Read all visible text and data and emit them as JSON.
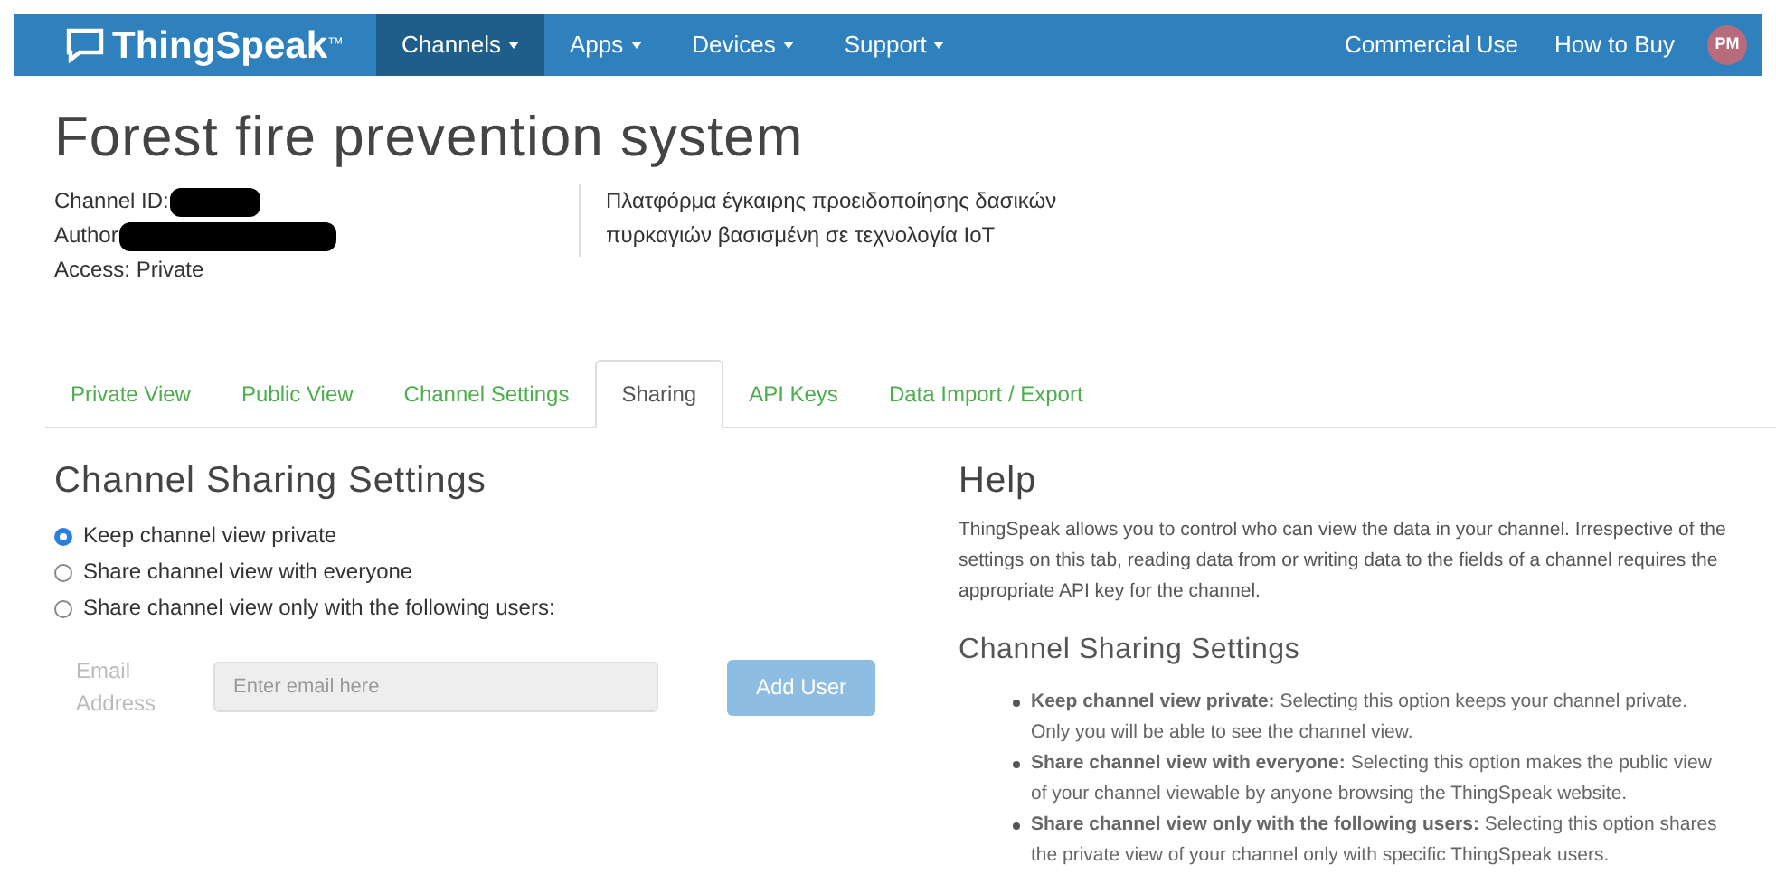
{
  "navbar": {
    "brand": "ThingSpeak",
    "trademark": "™",
    "menus": [
      {
        "label": "Channels",
        "selected": true
      },
      {
        "label": "Apps",
        "selected": false
      },
      {
        "label": "Devices",
        "selected": false
      },
      {
        "label": "Support",
        "selected": false
      }
    ],
    "right_links": [
      "Commercial Use",
      "How to Buy"
    ],
    "avatar": "PM"
  },
  "channel": {
    "title": "Forest fire prevention system",
    "info": [
      {
        "text": "Channel ID:",
        "redacted": true
      },
      {
        "text": "Author",
        "redacted": true
      },
      {
        "text": "Access: Private",
        "redacted": false
      }
    ],
    "description": "Πλατφόρμα   έγκαιρης προειδοποίησης δασικών πυρκαγιών βασισμένη σε τεχνολογία IoT"
  },
  "tabs": [
    {
      "label": "Private View",
      "selected": false
    },
    {
      "label": "Public View",
      "selected": false
    },
    {
      "label": "Channel Settings",
      "selected": false
    },
    {
      "label": "Sharing",
      "selected": true
    },
    {
      "label": "API Keys",
      "selected": false
    },
    {
      "label": "Data Import / Export",
      "selected": false
    }
  ],
  "sharing": {
    "heading": "Channel Sharing Settings",
    "options": [
      {
        "label": "Keep channel view private",
        "selected": true
      },
      {
        "label": "Share channel view with everyone",
        "selected": false
      },
      {
        "label": "Share channel view only with the following users:",
        "selected": false
      }
    ],
    "email_label": "Email Address",
    "email_placeholder": "Enter email here",
    "add_button": "Add User",
    "disabled": true
  },
  "help": {
    "heading": "Help",
    "intro": "ThingSpeak allows you to control who can view the data in your channel. Irrespective of the settings on this tab, reading data from or writing data to the fields of a channel requires the appropriate API key for the channel.",
    "subheading": "Channel Sharing Settings",
    "items": [
      "**Keep channel view private:** Selecting this option keeps your channel private. Only you will be able to see the channel view.",
      "**Share channel view with everyone:** Selecting this option makes the public view of your channel viewable by anyone browsing the ThingSpeak website.",
      "**Share channel view only with the following users:** Selecting this option shares the private view of your channel only with specific ThingSpeak users."
    ]
  }
}
